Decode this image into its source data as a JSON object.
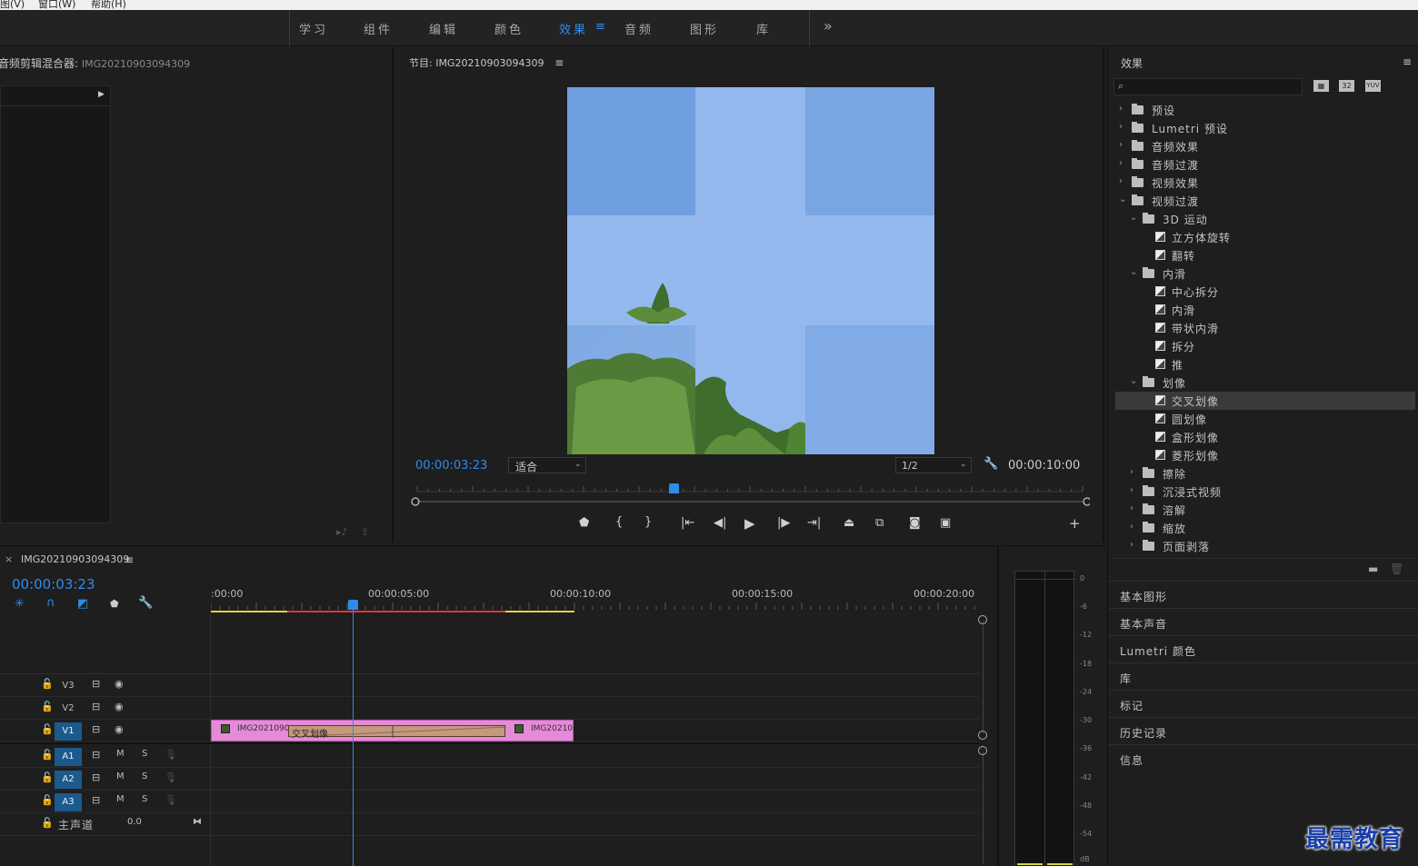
{
  "menubar": {
    "items": [
      "图(V)",
      "窗口(W)",
      "帮助(H)"
    ]
  },
  "workspaces": {
    "tabs": [
      "学习",
      "组件",
      "编辑",
      "颜色",
      "效果",
      "音频",
      "图形",
      "库"
    ],
    "active": "效果",
    "overflow": "»",
    "menu_icon": "≡"
  },
  "mixer": {
    "title": "音频剪辑混合器:",
    "clip": "IMG20210903094309"
  },
  "program": {
    "title": "节目: IMG20210903094309",
    "timecode": "00:00:03:23",
    "fit": "适合",
    "resolution": "1/2",
    "duration": "00:00:10:00",
    "playhead_fraction": 0.385
  },
  "effects": {
    "title": "效果",
    "search_placeholder": "",
    "filter_badges": [
      "32",
      "YUV"
    ],
    "tree": [
      {
        "type": "folder",
        "indent": 0,
        "open": false,
        "label": "预设",
        "special": true
      },
      {
        "type": "folder",
        "indent": 0,
        "open": false,
        "label": "Lumetri 预设",
        "special": true
      },
      {
        "type": "folder",
        "indent": 0,
        "open": false,
        "label": "音频效果"
      },
      {
        "type": "folder",
        "indent": 0,
        "open": false,
        "label": "音频过渡"
      },
      {
        "type": "folder",
        "indent": 0,
        "open": false,
        "label": "视频效果"
      },
      {
        "type": "folder",
        "indent": 0,
        "open": true,
        "label": "视频过渡"
      },
      {
        "type": "folder",
        "indent": 1,
        "open": true,
        "label": "3D 运动"
      },
      {
        "type": "fx",
        "indent": 2,
        "label": "立方体旋转"
      },
      {
        "type": "fx",
        "indent": 2,
        "label": "翻转"
      },
      {
        "type": "folder",
        "indent": 1,
        "open": true,
        "label": "内滑"
      },
      {
        "type": "fx",
        "indent": 2,
        "label": "中心拆分"
      },
      {
        "type": "fx",
        "indent": 2,
        "label": "内滑"
      },
      {
        "type": "fx",
        "indent": 2,
        "label": "带状内滑"
      },
      {
        "type": "fx",
        "indent": 2,
        "label": "拆分"
      },
      {
        "type": "fx",
        "indent": 2,
        "label": "推"
      },
      {
        "type": "folder",
        "indent": 1,
        "open": true,
        "label": "划像"
      },
      {
        "type": "fx",
        "indent": 2,
        "label": "交叉划像",
        "selected": true
      },
      {
        "type": "fx",
        "indent": 2,
        "label": "圆划像"
      },
      {
        "type": "fx",
        "indent": 2,
        "label": "盒形划像"
      },
      {
        "type": "fx",
        "indent": 2,
        "label": "菱形划像"
      },
      {
        "type": "folder",
        "indent": 1,
        "open": false,
        "label": "擦除"
      },
      {
        "type": "folder",
        "indent": 1,
        "open": false,
        "label": "沉浸式视频"
      },
      {
        "type": "folder",
        "indent": 1,
        "open": false,
        "label": "溶解"
      },
      {
        "type": "folder",
        "indent": 1,
        "open": false,
        "label": "缩放"
      },
      {
        "type": "folder",
        "indent": 1,
        "open": false,
        "label": "页面剥落"
      }
    ]
  },
  "side_panels": [
    "基本图形",
    "基本声音",
    "Lumetri 颜色",
    "库",
    "标记",
    "历史记录",
    "信息"
  ],
  "timeline": {
    "tab": "IMG20210903094309",
    "timecode": "00:00:03:23",
    "ruler": [
      ":00:00",
      "00:00:05:00",
      "00:00:10:00",
      "00:00:15:00",
      "00:00:20:00"
    ],
    "video_tracks": [
      "V3",
      "V2",
      "V1"
    ],
    "audio_tracks": [
      "A1",
      "A2",
      "A3"
    ],
    "master": {
      "label": "主声道",
      "value": "0.0"
    },
    "m_label": "M",
    "s_label": "S",
    "clip_left": "IMG2021090",
    "transition": "交叉划像",
    "clip_right": "IMG20210"
  },
  "meter": {
    "labels": [
      "0",
      "-6",
      "-12",
      "-18",
      "-24",
      "-30",
      "-36",
      "-42",
      "-48",
      "-54",
      "dB"
    ]
  },
  "watermark": "最需教育",
  "colors": {
    "accent": "#2d8ceb",
    "clip": "#e58ad8",
    "transition": "#c49a7d",
    "track_on": "#1c5a8c"
  }
}
